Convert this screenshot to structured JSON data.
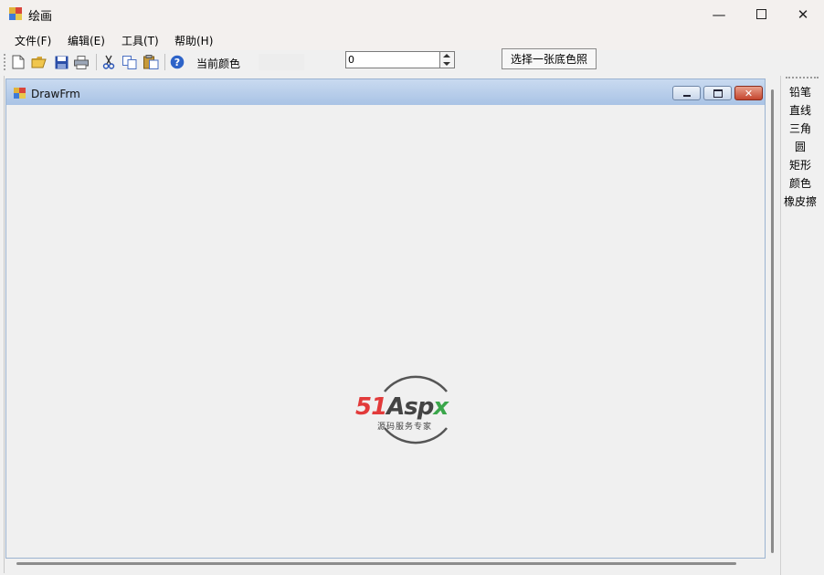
{
  "window": {
    "title": "绘画"
  },
  "menu": [
    "文件(F)",
    "编辑(E)",
    "工具(T)",
    "帮助(H)"
  ],
  "toolbar": {
    "buttons": [
      "new-icon",
      "open-icon",
      "save-icon",
      "print-icon",
      "cut-icon",
      "copy-icon",
      "paste-icon",
      "help-icon"
    ],
    "color_label": "当前颜色",
    "number_value": "0",
    "bg_button": "选择一张底色照"
  },
  "child": {
    "title": "DrawFrm"
  },
  "watermark": {
    "brand_red": "51",
    "brand_dark": "Asp",
    "brand_green": "x",
    "tagline": "源码服务专家"
  },
  "tools": [
    "铅笔",
    "直线",
    "三角",
    "圆",
    "矩形",
    "颜色",
    "橡皮擦"
  ],
  "colors": {
    "title_bg": "#f3f0ee",
    "mdi_title": "#b9cfeb",
    "red": "#e23a3a",
    "green": "#3aa64a"
  }
}
